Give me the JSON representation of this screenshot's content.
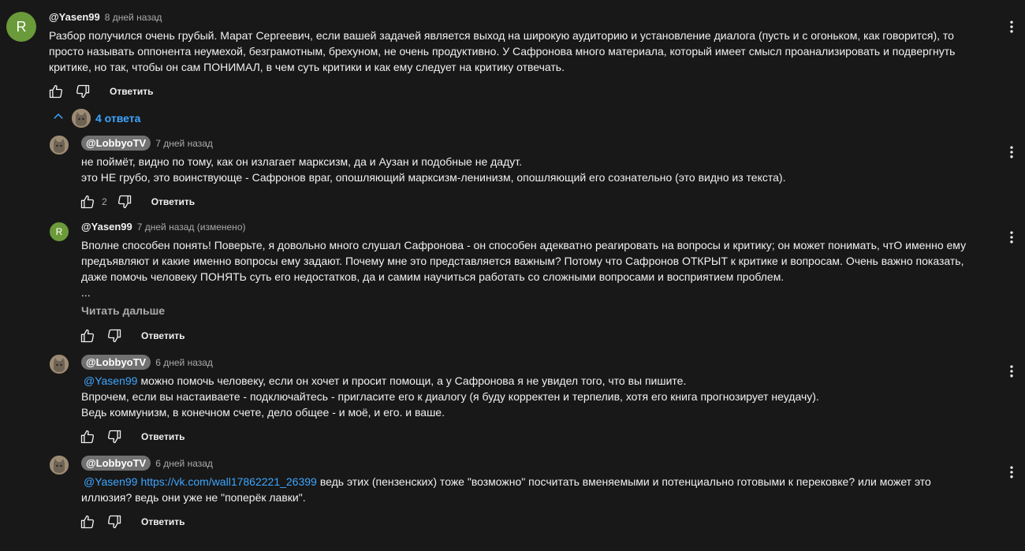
{
  "colors": {
    "background": "#181818",
    "text": "#f1f1f1",
    "muted": "#aaaaaa",
    "accent": "#3ea6ff",
    "avatar_green": "#6b9a3a"
  },
  "comment": {
    "avatar_letter": "R",
    "author": "@Yasen99",
    "time": "8 дней назад",
    "lines": [
      "Разбор получился очень грубый.  Марат Сергеевич, если вашей задачей является выход на широкую аудиторию и установление диалога (пусть и с огоньком, как говорится), то",
      "просто называть оппонента неумехой, безграмотным, брехуном, не очень продуктивно.  У Сафронова много материала, который имеет смысл проанализировать и подвергнуть",
      "критике, но так, чтобы он сам ПОНИМАЛ, в чем суть критики и как ему следует на критику отвечать."
    ],
    "reply_label": "Ответить"
  },
  "replies_toggle": {
    "label": "4 ответа",
    "icon": "chevron-up-icon"
  },
  "replies": [
    {
      "author": "@LobbyoTV",
      "time": "7 дней назад",
      "lines": [
        "не поймёт, видно по тому, как он излагает марксизм, да и Аузан и подобные не дадут.",
        "это НЕ грубо, это воинствующе - Сафронов враг, опошляющий марксизм-ленинизм, опошляющий его сознательно (это видно из текста)."
      ],
      "likes": "2",
      "reply_label": "Ответить"
    },
    {
      "avatar_letter": "R",
      "author": "@Yasen99",
      "time": "7 дней назад (изменено)",
      "lines": [
        "Вполне способен понять!  Поверьте, я довольно много слушал Сафронова - он способен адекватно реагировать на вопросы и критику; он может понимать, чтО именно ему",
        "предъявляют и какие именно вопросы ему задают.  Почему мне это представляется важным?  Потому что Сафронов ОТКРЫТ к критике и вопросам.  Очень важно показать,",
        "даже помочь человеку ПОНЯТЬ суть его недостатков, да и самим научиться работать со сложными вопросами и восприятием проблем.",
        "..."
      ],
      "read_more": "Читать дальше",
      "reply_label": "Ответить"
    },
    {
      "author": "@LobbyoTV",
      "time": "6 дней назад",
      "mention": "@Yasen99",
      "lines": [
        "можно помочь человеку, если он хочет и просит помощи, а у Сафронова я не увидел того, что вы пишите.",
        "Впрочем, если вы настаиваете - подключайтесь - пригласите его к диалогу (я буду корректен и терпелив, хотя его книга прогнозирует неудачу).",
        "Ведь коммунизм, в конечном счете, дело общее - и моё, и его. и ваше."
      ],
      "reply_label": "Ответить"
    },
    {
      "author": "@LobbyoTV",
      "time": "6 дней назад",
      "mention": "@Yasen99",
      "link": "https://vk.com/wall17862221_26399",
      "lines": [
        "ведь этих (пензенских) тоже \"возможно\" посчитать вменяемыми и потенциально готовыми к перековке? или может это",
        "иллюзия? ведь они уже не \"поперёк лавки\"."
      ],
      "reply_label": "Ответить"
    }
  ]
}
